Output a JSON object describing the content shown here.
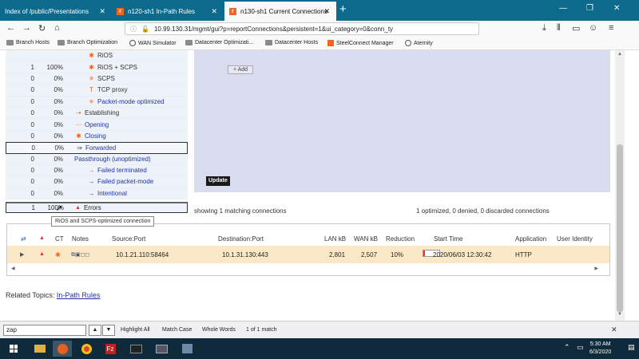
{
  "browser": {
    "tabs": [
      {
        "title": "Index of /public/Presentations",
        "favicon": ""
      },
      {
        "title": "n120-sh1 In-Path Rules",
        "favicon": "riverbed"
      },
      {
        "title": "n130-sh1 Current Connections",
        "favicon": "riverbed"
      }
    ],
    "url": "10.99.130.31/mgmt/gui?p=reportConnections&persistent=1&ui_category=0&conn_ty",
    "bookmarks": [
      "Branch Hosts",
      "Branch Optimization",
      "WAN Simulator",
      "Datacenter Optimizati...",
      "Datacenter Hosts",
      "SteelConnect Manager",
      "Aternity"
    ]
  },
  "categories": [
    {
      "count": "",
      "pct": "",
      "label": "RiOS",
      "icon": "rios-icon",
      "blue": false,
      "indent": 3
    },
    {
      "count": "1",
      "pct": "100%",
      "label": "RiOS + SCPS",
      "icon": "rios-scps-icon",
      "blue": false,
      "indent": 3
    },
    {
      "count": "0",
      "pct": "0%",
      "label": "SCPS",
      "icon": "scps-icon",
      "blue": false,
      "indent": 3
    },
    {
      "count": "0",
      "pct": "0%",
      "label": "TCP proxy",
      "icon": "tcp-proxy-icon",
      "blue": false,
      "indent": 3
    },
    {
      "count": "0",
      "pct": "0%",
      "label": "Packet-mode optimized",
      "icon": "packet-mode-icon",
      "blue": true,
      "indent": 3
    },
    {
      "count": "0",
      "pct": "0%",
      "label": "Establishing",
      "icon": "establishing-icon",
      "blue": false,
      "indent": 2
    },
    {
      "count": "0",
      "pct": "0%",
      "label": "Opening",
      "icon": "opening-icon",
      "blue": true,
      "indent": 2
    },
    {
      "count": "0",
      "pct": "0%",
      "label": "Closing",
      "icon": "closing-icon",
      "blue": true,
      "indent": 2
    },
    {
      "count": "0",
      "pct": "0%",
      "label": "Forwarded",
      "icon": "forwarded-icon",
      "blue": true,
      "indent": 2,
      "boxed": true
    },
    {
      "count": "0",
      "pct": "0%",
      "label": "Passthrough (unoptimized)",
      "icon": "",
      "blue": true,
      "indent": 2
    },
    {
      "count": "0",
      "pct": "0%",
      "label": "Failed terminated",
      "icon": "failed-terminated-icon",
      "blue": true,
      "indent": 3
    },
    {
      "count": "0",
      "pct": "0%",
      "label": "Failed packet-mode",
      "icon": "failed-packet-icon",
      "blue": true,
      "indent": 3
    },
    {
      "count": "0",
      "pct": "0%",
      "label": "Intentional",
      "icon": "intentional-icon",
      "blue": true,
      "indent": 3
    }
  ],
  "errors": {
    "count": "1",
    "pct": "100%",
    "label": "Errors"
  },
  "filter": {
    "add_label": "+ Add",
    "update_label": "Update"
  },
  "showing": "showing 1 matching connections",
  "summary": "1 optimized, 0 denied, 0 discarded connections",
  "table": {
    "headers": {
      "ct": "CT",
      "notes": "Notes",
      "source": "Source:Port",
      "destination": "Destination:Port",
      "lan": "LAN kB",
      "wan": "WAN kB",
      "reduction": "Reduction",
      "start": "Start Time",
      "app": "Application",
      "user": "User Identity"
    },
    "row": {
      "source": "10.1.21.110:58464",
      "destination": "10.1.31.130:443",
      "lan": "2,801",
      "wan": "2,507",
      "reduction": "10%",
      "reduction_fraction": 0.1,
      "start": "2020/06/03 12:30:42",
      "app": "HTTP"
    },
    "tooltip": "RiOS and SCPS-optimized connection"
  },
  "related": {
    "prefix": "Related Topics:",
    "link": "In-Path Rules"
  },
  "find": {
    "query": "zap",
    "highlight_all": "Highlight All",
    "match_case": "Match Case",
    "whole_words": "Whole Words",
    "result": "1 of 1 match"
  },
  "clock": {
    "time": "5:30 AM",
    "date": "6/3/2020"
  },
  "colors": {
    "tabstrip": "#0c6a8c",
    "accent": "#f26522",
    "row_highlight": "#fbe8c6",
    "filter_panel": "#d8dcee"
  }
}
